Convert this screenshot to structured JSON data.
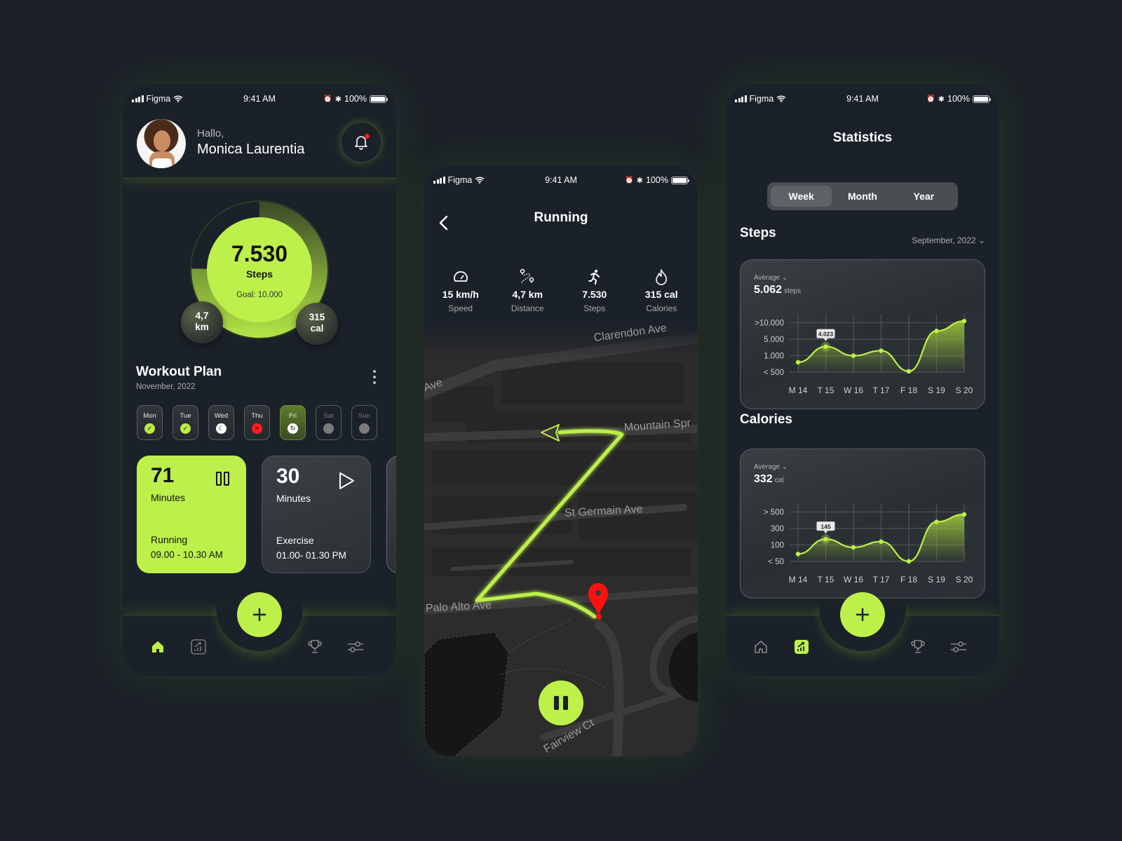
{
  "colors": {
    "accent": "#bdf04a",
    "background": "#1b2127",
    "danger": "#ff1e1e"
  },
  "status_bar": {
    "carrier": "Figma",
    "time": "9:41 AM",
    "battery": "100%",
    "icons": [
      "signal-icon",
      "wifi-icon",
      "alarm-icon",
      "bluetooth-icon",
      "battery-icon"
    ]
  },
  "home": {
    "greeting": "Hallo,",
    "user_name": "Monica Laurentia",
    "notification_badge": true,
    "steps": {
      "value": "7.530",
      "label": "Steps",
      "goal": "Goal: 10.000",
      "progress": 0.753
    },
    "distance_bubble": {
      "value": "4,7",
      "unit": "km"
    },
    "calories_bubble": {
      "value": "315",
      "unit": "cal"
    },
    "workout_plan": {
      "title": "Workout Plan",
      "subtitle": "November, 2022",
      "days": [
        {
          "label": "Mon",
          "status": "done"
        },
        {
          "label": "Tue",
          "status": "done"
        },
        {
          "label": "Wed",
          "status": "sleep"
        },
        {
          "label": "Thu",
          "status": "missed"
        },
        {
          "label": "Fri",
          "status": "in-progress"
        },
        {
          "label": "Sat",
          "status": "upcoming"
        },
        {
          "label": "Sun",
          "status": "upcoming"
        }
      ]
    },
    "workouts": [
      {
        "minutes": "71",
        "unit": "Minutes",
        "type": "Running",
        "time": "09.00 - 10.30 AM",
        "control": "pause"
      },
      {
        "minutes": "30",
        "unit": "Minutes",
        "type": "Exercise",
        "time": "01.00- 01.30 PM",
        "control": "play"
      }
    ]
  },
  "running": {
    "title": "Running",
    "stats": [
      {
        "icon": "speedometer-icon",
        "value": "15 km/h",
        "label": "Speed"
      },
      {
        "icon": "route-icon",
        "value": "4,7 km",
        "label": "Distance"
      },
      {
        "icon": "runner-icon",
        "value": "7.530",
        "label": "Steps"
      },
      {
        "icon": "flame-icon",
        "value": "315 cal",
        "label": "Calories"
      }
    ],
    "map_labels": {
      "clarendon": "Clarendon Ave",
      "ave": "Ave",
      "mountain": "Mountain Spr",
      "st_germain": "St Germain Ave",
      "palo_alto": "Palo Alto Ave",
      "fairview": "Fairview Ct"
    }
  },
  "stats": {
    "title": "Statistics",
    "periods": [
      "Week",
      "Month",
      "Year"
    ],
    "active_period": "Week",
    "steps_section": "Steps",
    "month_selector": "September, 2022",
    "calories_section": "Calories"
  },
  "chart_data": [
    {
      "type": "area",
      "title": "Steps",
      "average_label": "Average",
      "average_value": "5.062",
      "average_unit": "steps",
      "categories": [
        "M 14",
        "T 15",
        "W 16",
        "T 17",
        "F 18",
        "S 19",
        "S 20"
      ],
      "y_tick_labels": [
        "< 500",
        "1.000",
        "5.000",
        ">10.000"
      ],
      "values_on_tick_scale": [
        0.6,
        1.55,
        1.0,
        1.3,
        0.05,
        2.5,
        3.1
      ],
      "highlight": {
        "category": "T 15",
        "label": "4.023"
      },
      "grid": true
    },
    {
      "type": "area",
      "title": "Calories",
      "average_label": "Average",
      "average_value": "332",
      "average_unit": "cal",
      "categories": [
        "M 14",
        "T 15",
        "W 16",
        "T 17",
        "F 18",
        "S 19",
        "S 20"
      ],
      "y_tick_labels": [
        "< 50",
        "100",
        "300",
        "> 500"
      ],
      "values_on_tick_scale": [
        0.45,
        1.35,
        0.85,
        1.2,
        0.0,
        2.4,
        2.85
      ],
      "highlight": {
        "category": "T 15",
        "label": "145"
      },
      "grid": true
    }
  ],
  "tabbar": {
    "items": [
      "home",
      "statistics",
      "trophy",
      "settings"
    ],
    "add_button": "+"
  }
}
